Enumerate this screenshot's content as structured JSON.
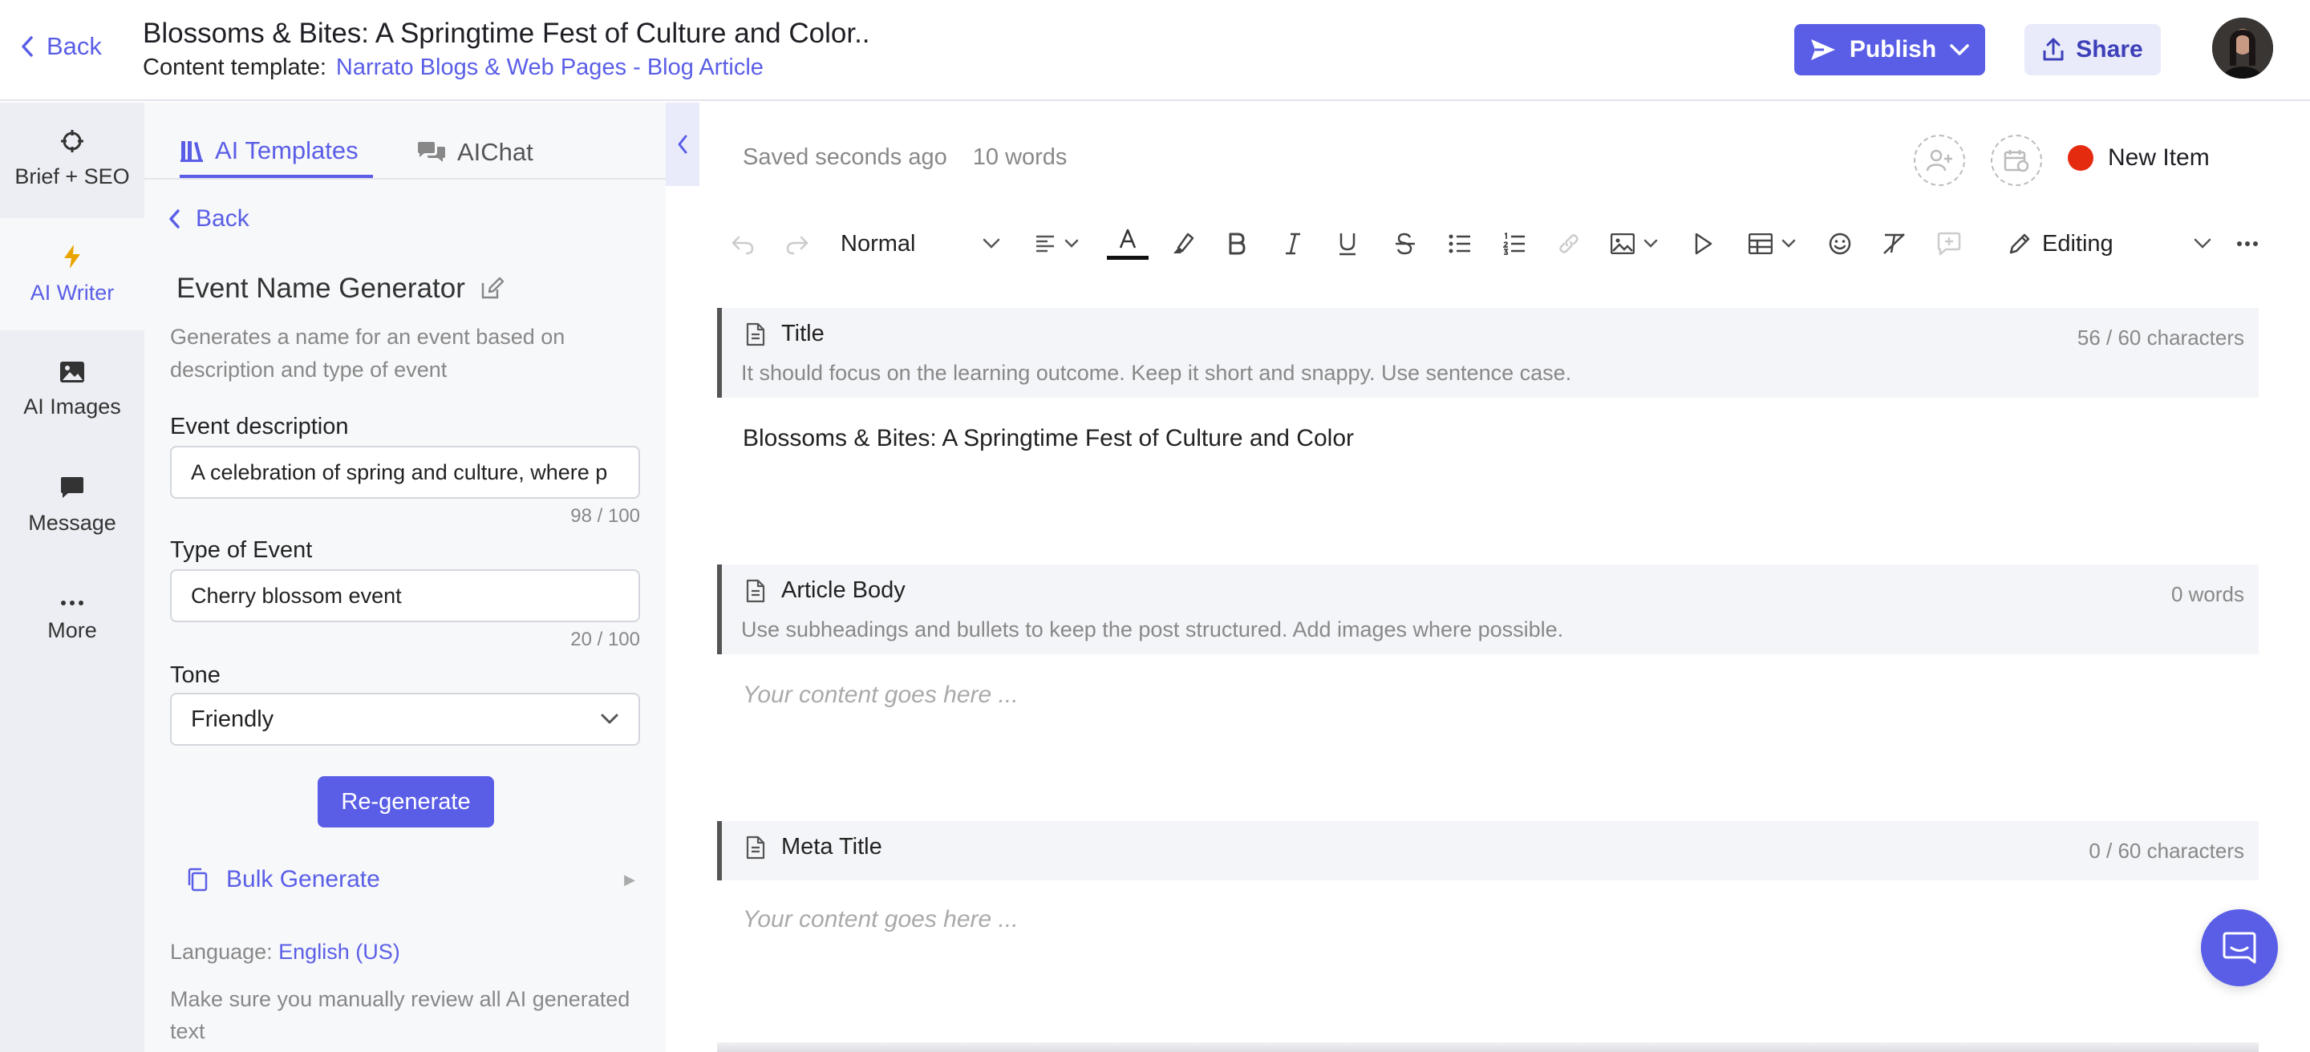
{
  "header": {
    "back_label": "Back",
    "title": "Blossoms & Bites: A Springtime Fest of Culture and Color..",
    "template_label": "Content template:",
    "template_name": "Narrato Blogs & Web Pages - Blog Article",
    "publish_label": "Publish",
    "share_label": "Share"
  },
  "nav": {
    "items": [
      {
        "label": "Brief + SEO",
        "icon": "crosshair-icon"
      },
      {
        "label": "AI Writer",
        "icon": "bolt-icon"
      },
      {
        "label": "AI Images",
        "icon": "image-icon"
      },
      {
        "label": "Message",
        "icon": "message-icon"
      },
      {
        "label": "More",
        "icon": "more-icon"
      }
    ],
    "active_color": "#5a5ee6"
  },
  "panel": {
    "tabs": [
      "AI Templates",
      "AIChat"
    ],
    "back_label": "Back",
    "generator_title": "Event Name Generator",
    "generator_desc": "Generates a name for an event based on description and type of event",
    "fields": {
      "event_description": {
        "label": "Event description",
        "value": "A celebration of spring and culture, where p",
        "counter": "98 / 100"
      },
      "type_of_event": {
        "label": "Type of Event",
        "value": "Cherry blossom event",
        "counter": "20 / 100"
      },
      "tone": {
        "label": "Tone",
        "value": "Friendly"
      }
    },
    "regenerate_label": "Re-generate",
    "bulk_generate_label": "Bulk Generate",
    "language_label": "Language:",
    "language_value": "English (US)",
    "review_note": "Make sure you manually review all AI generated text"
  },
  "editor": {
    "saved_status": "Saved seconds ago",
    "word_count": "10 words",
    "new_item_label": "New Item",
    "toolbar": {
      "style_value": "Normal",
      "mode_value": "Editing"
    },
    "sections": [
      {
        "title": "Title",
        "hint": "It should focus on the learning outcome. Keep it short and snappy. Use sentence case.",
        "count": "56 / 60 characters",
        "content": "Blossoms & Bites: A Springtime Fest of Culture and Color"
      },
      {
        "title": "Article Body",
        "hint": "Use subheadings and bullets to keep the post structured. Add images where possible.",
        "count": "0 words",
        "placeholder": "Your content goes here ..."
      },
      {
        "title": "Meta Title",
        "count": "0 / 60 characters",
        "placeholder": "Your content goes here ..."
      }
    ]
  },
  "colors": {
    "accent": "#5a5ee6",
    "status_dot": "#e52b0f"
  }
}
